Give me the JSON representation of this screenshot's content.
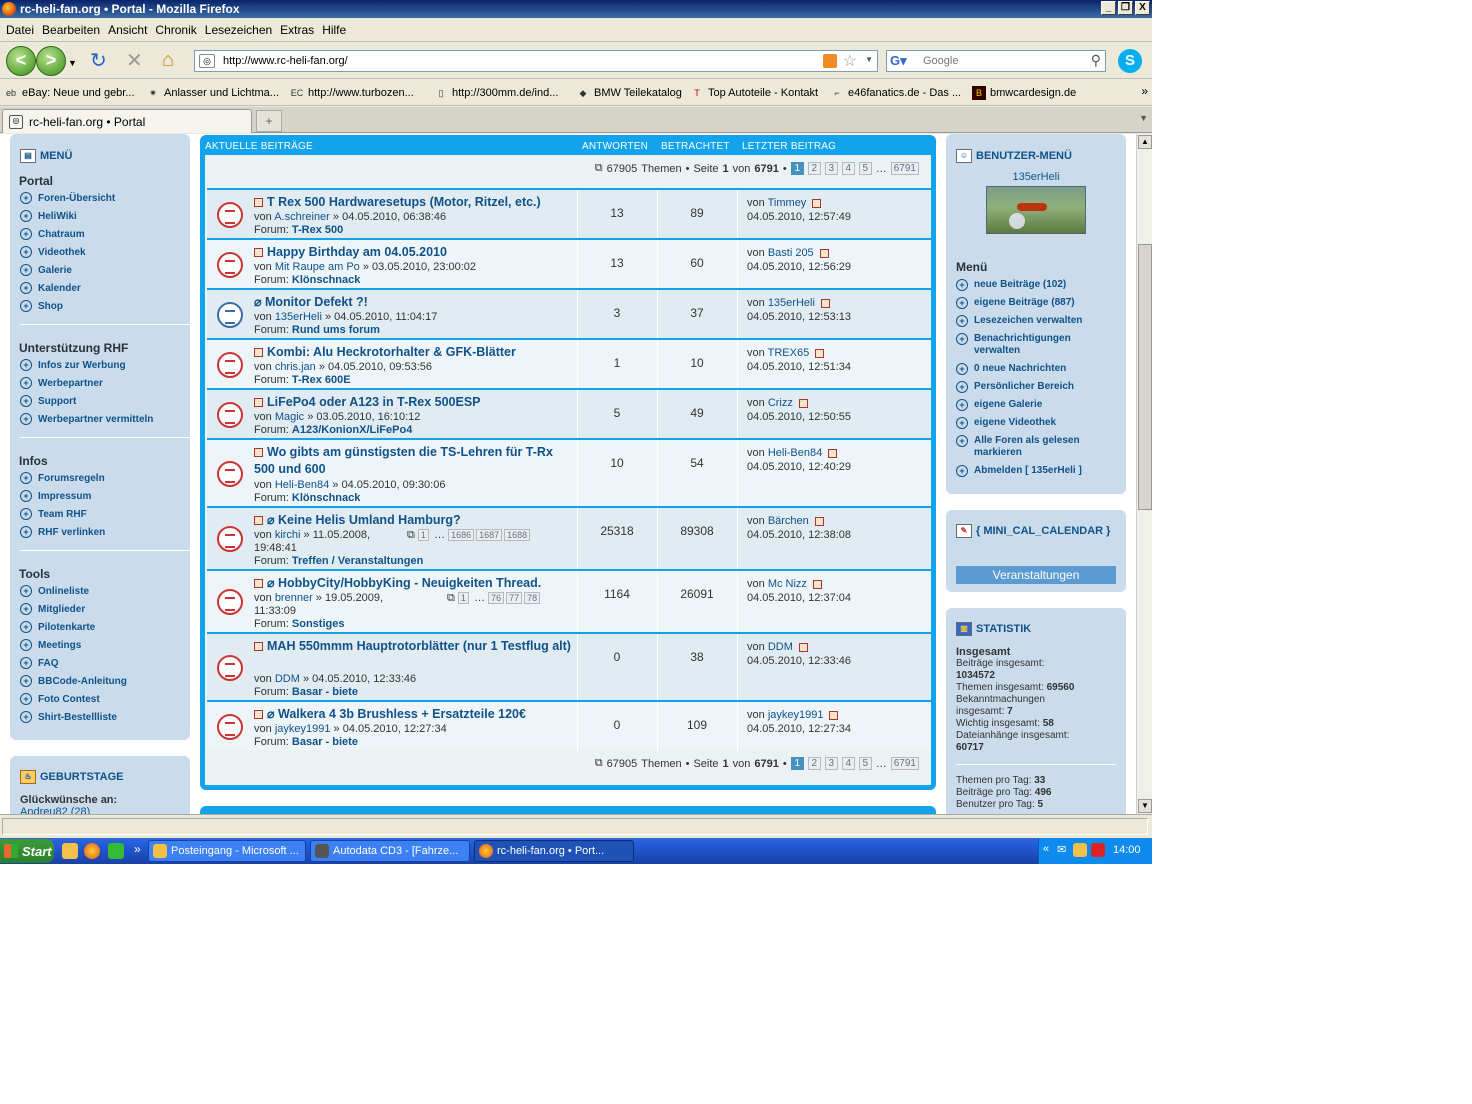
{
  "window": {
    "title": "rc-heli-fan.org • Portal - Mozilla Firefox",
    "btn_min": "_",
    "btn_max": "❐",
    "btn_close": "X"
  },
  "menubar": [
    "Datei",
    "Bearbeiten",
    "Ansicht",
    "Chronik",
    "Lesezeichen",
    "Extras",
    "Hilfe"
  ],
  "nav": {
    "url": "http://www.rc-heli-fan.org/",
    "search_placeholder": "Google",
    "back": "<",
    "forward": ">",
    "reload": "↻",
    "stop": "✕",
    "home": "⌂"
  },
  "bookmarks": [
    "eBay: Neue und gebr...",
    "Anlasser und Lichtma...",
    "http://www.turbozen...",
    "http://300mm.de/ind...",
    "BMW Teilekatalog",
    "Top Autoteile - Kontakt",
    "e46fanatics.de - Das ...",
    "bmwcardesign.de"
  ],
  "tab": {
    "label": "rc-heli-fan.org • Portal"
  },
  "left": {
    "menu_title": "MENÜ",
    "sections": [
      {
        "title": "Portal",
        "items": [
          "Foren-Übersicht",
          "HeliWiki",
          "Chatraum",
          "Videothek",
          "Galerie",
          "Kalender",
          "Shop"
        ]
      },
      {
        "title": "Unterstützung RHF",
        "items": [
          "Infos zur Werbung",
          "Werbepartner",
          "Support",
          "Werbepartner vermitteln"
        ]
      },
      {
        "title": "Infos",
        "items": [
          "Forumsregeln",
          "Impressum",
          "Team RHF",
          "RHF verlinken"
        ]
      },
      {
        "title": "Tools",
        "items": [
          "Onlineliste",
          "Mitglieder",
          "Pilotenkarte",
          "Meetings",
          "FAQ",
          "BBCode-Anleitung",
          "Foto Contest",
          "Shirt-Bestellliste"
        ]
      }
    ],
    "birthday_title": "GEBURTSTAGE",
    "birthday_text": "Glückwünsche an:",
    "birthday_name": "Andreu82 (28)"
  },
  "main": {
    "header": {
      "topics": "AKTUELLE BEITRÄGE",
      "replies": "ANTWORTEN",
      "views": "BETRACHTET",
      "last": "LETZTER BEITRAG"
    },
    "pagination": {
      "count": "67905",
      "themen": "Themen",
      "seite": "Seite",
      "current": "1",
      "von": "von",
      "total": "6791",
      "pages": [
        "1",
        "2",
        "3",
        "4",
        "5"
      ],
      "last": "6791",
      "ellipsis": "…"
    },
    "topics": [
      {
        "title": "T Rex 500 Hardwaresetups (Motor, Ritzel, etc.)",
        "author": "A.schreiner",
        "date": "04.05.2010, 06:38:46",
        "forum": "T-Rex 500",
        "replies": "13",
        "views": "89",
        "last_user": "Timmey",
        "last_date": "04.05.2010, 12:57:49"
      },
      {
        "title": "Happy Birthday am 04.05.2010",
        "author": "Mit Raupe am Po",
        "date": "03.05.2010, 23:00:02",
        "forum": "Klönschnack",
        "replies": "13",
        "views": "60",
        "last_user": "Basti 205",
        "last_date": "04.05.2010, 12:56:29"
      },
      {
        "title": "Monitor Defekt ?!",
        "author": "135erHeli",
        "date": "04.05.2010, 11:04:17",
        "forum": "Rund ums forum",
        "replies": "3",
        "views": "37",
        "last_user": "135erHeli",
        "last_date": "04.05.2010, 12:53:13"
      },
      {
        "title": "Kombi: Alu Heckrotorhalter & GFK-Blätter",
        "author": "chris.jan",
        "date": "04.05.2010, 09:53:56",
        "forum": "T-Rex 600E",
        "replies": "1",
        "views": "10",
        "last_user": "TREX65",
        "last_date": "04.05.2010, 12:51:34"
      },
      {
        "title": "LiFePo4 oder A123 in T-Rex 500ESP",
        "author": "Magic",
        "date": "03.05.2010, 16:10:12",
        "forum": "A123/KonionX/LiFePo4",
        "replies": "5",
        "views": "49",
        "last_user": "Crizz",
        "last_date": "04.05.2010, 12:50:55"
      },
      {
        "title": "Wo gibts am günstigsten die TS-Lehren für T-Rx 500 und 600",
        "author": "Heli-Ben84",
        "date": "04.05.2010, 09:30:06",
        "forum": "Klönschnack",
        "replies": "10",
        "views": "54",
        "last_user": "Heli-Ben84",
        "last_date": "04.05.2010, 12:40:29"
      },
      {
        "title": "Keine Helis Umland Hamburg?",
        "author": "kirchi",
        "date": "11.05.2008,",
        "date2": "19:48:41",
        "forum": "Treffen / Veranstaltungen",
        "replies": "25318",
        "views": "89308",
        "last_user": "Bärchen",
        "last_date": "04.05.2010, 12:38:08",
        "pages": [
          "1",
          "1686",
          "1687",
          "1688"
        ]
      },
      {
        "title": "HobbyCity/HobbyKing - Neuigkeiten Thread.",
        "author": "brenner",
        "date": "19.05.2009,",
        "date2": "11:33:09",
        "forum": "Sonstiges",
        "replies": "1164",
        "views": "26091",
        "last_user": "Mc Nizz",
        "last_date": "04.05.2010, 12:37:04",
        "pages": [
          "1",
          "76",
          "77",
          "78"
        ]
      },
      {
        "title": "MAH 550mmm Hauptrotorblätter (nur 1 Testflug alt)",
        "author": "DDM",
        "date": "04.05.2010, 12:33:46",
        "forum": "Basar - biete",
        "replies": "0",
        "views": "38",
        "last_user": "DDM",
        "last_date": "04.05.2010, 12:33:46"
      },
      {
        "title": "Walkera 4 3b Brushless + Ersatzteile 120€",
        "author": "jaykey1991",
        "date": "04.05.2010, 12:27:34",
        "forum": "Basar - biete",
        "replies": "0",
        "views": "109",
        "last_user": "jaykey1991",
        "last_date": "04.05.2010, 12:27:34"
      }
    ],
    "von": "von",
    "forum_label": "Forum:",
    "sep": "»"
  },
  "right": {
    "user_title": "BENUTZER-MENÜ",
    "username": "135erHeli",
    "menu_label": "Menü",
    "links": [
      "neue Beiträge (102)",
      "eigene Beiträge (887)",
      "Lesezeichen verwalten",
      "Benachrichtigungen verwalten",
      "0 neue Nachrichten",
      "Persönlicher Bereich",
      "eigene Galerie",
      "eigene Videothek",
      "Alle Foren als gelesen markieren",
      "Abmelden [ 135erHeli ]"
    ],
    "calendar_title": "{ MINI_CAL_CALENDAR }",
    "events_button": "Veranstaltungen",
    "stats_title": "STATISTIK",
    "stats_heading": "Insgesamt",
    "stats": [
      {
        "label": "Beiträge insgesamt:",
        "value": "1034572"
      },
      {
        "label": "Themen insgesamt:",
        "value": "69560"
      },
      {
        "label": "Bekanntmachungen insgesamt:",
        "value": "7"
      },
      {
        "label": "Wichtig insgesamt:",
        "value": "58"
      },
      {
        "label": "Dateianhänge insgesamt:",
        "value": "60717"
      }
    ],
    "daily": [
      {
        "label": "Themen pro Tag:",
        "value": "33"
      },
      {
        "label": "Beiträge pro Tag:",
        "value": "496"
      },
      {
        "label": "Benutzer pro Tag:",
        "value": "5"
      }
    ]
  },
  "taskbar": {
    "start": "Start",
    "tasks": [
      "Posteingang - Microsoft ...",
      "Autodata CD3 - [Fahrze...",
      "rc-heli-fan.org • Port..."
    ],
    "clock": "14:00",
    "tray_arrows": "«",
    "ql_more": "»"
  }
}
